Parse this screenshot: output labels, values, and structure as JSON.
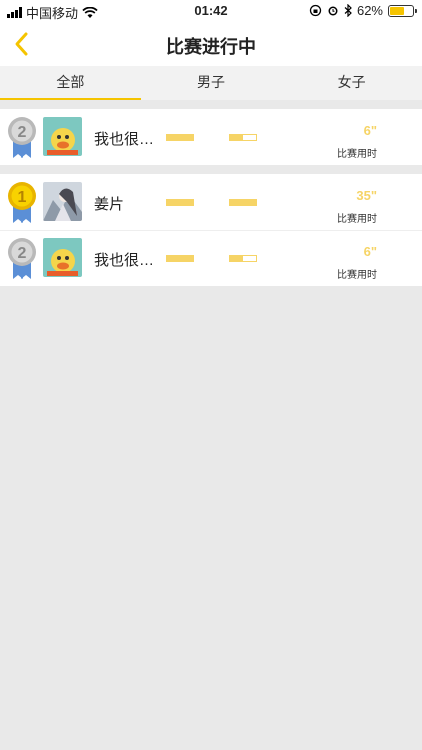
{
  "status_bar": {
    "carrier": "中国移动",
    "time": "01:42",
    "battery": "62%",
    "battery_level": 0.62
  },
  "nav": {
    "title": "比赛进行中",
    "back_icon": "chevron-left-icon",
    "accent": "#f5c400"
  },
  "tabs": [
    {
      "label": "全部",
      "active": true
    },
    {
      "label": "男子",
      "active": false
    },
    {
      "label": "女子",
      "active": false
    }
  ],
  "my_entry": {
    "rank": "2",
    "medal": "silver",
    "name": "我也很…",
    "progress_1": 1.0,
    "progress_2": 0.5,
    "time_value": "6\"",
    "time_label": "比赛用时"
  },
  "rankings": [
    {
      "rank": "1",
      "medal": "gold",
      "name": "姜片",
      "progress_1": 1.0,
      "progress_2": 1.0,
      "time_value": "35\"",
      "time_label": "比赛用时"
    },
    {
      "rank": "2",
      "medal": "silver",
      "name": "我也很…",
      "progress_1": 1.0,
      "progress_2": 0.5,
      "time_value": "6\"",
      "time_label": "比赛用时"
    }
  ]
}
